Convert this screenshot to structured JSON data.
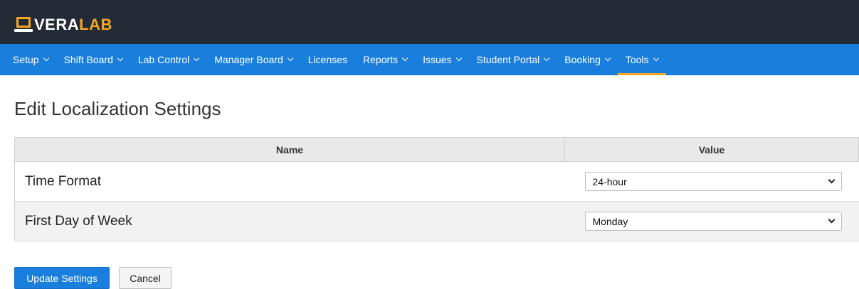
{
  "brand": {
    "name_part1": "VERA",
    "name_part2": "LAB",
    "accent_color": "#f5a623",
    "topbar_color": "#232b36",
    "nav_color": "#1a7fdc"
  },
  "nav": {
    "items": [
      {
        "label": "Setup",
        "dropdown": true
      },
      {
        "label": "Shift Board",
        "dropdown": true
      },
      {
        "label": "Lab Control",
        "dropdown": true
      },
      {
        "label": "Manager Board",
        "dropdown": true
      },
      {
        "label": "Licenses",
        "dropdown": false
      },
      {
        "label": "Reports",
        "dropdown": true
      },
      {
        "label": "Issues",
        "dropdown": true
      },
      {
        "label": "Student Portal",
        "dropdown": true
      },
      {
        "label": "Booking",
        "dropdown": true
      },
      {
        "label": "Tools",
        "dropdown": true,
        "active": true
      }
    ]
  },
  "page": {
    "title": "Edit Localization Settings"
  },
  "table": {
    "headers": {
      "name": "Name",
      "value": "Value"
    },
    "rows": [
      {
        "name": "Time Format",
        "value": "24-hour"
      },
      {
        "name": "First Day of Week",
        "value": "Monday"
      }
    ]
  },
  "actions": {
    "update_label": "Update Settings",
    "cancel_label": "Cancel"
  }
}
